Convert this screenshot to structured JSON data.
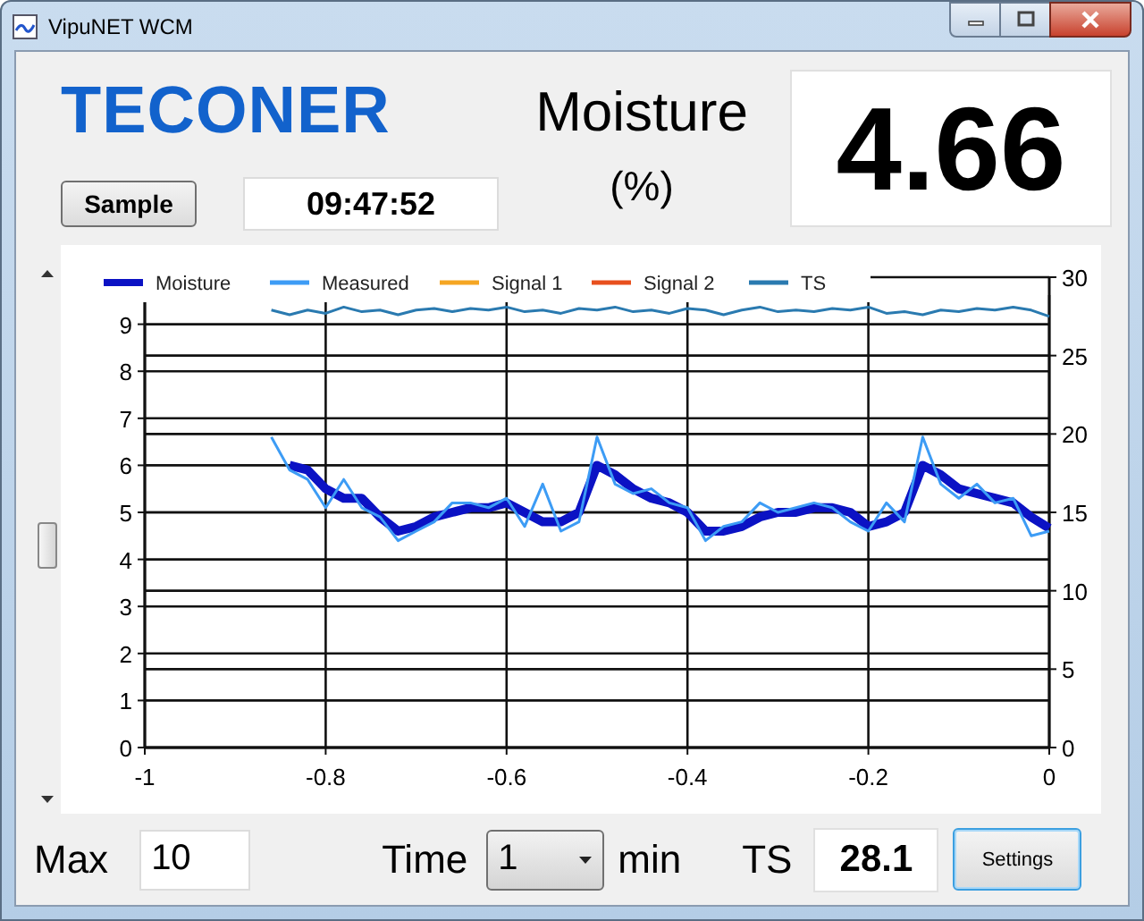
{
  "window": {
    "title": "VipuNET WCM"
  },
  "logo": "TECONER",
  "sample_button": "Sample",
  "time": "09:47:52",
  "measure_label": "Moisture",
  "measure_unit": "(%)",
  "reading": "4.66",
  "chart": {
    "chart_data": {
      "type": "line",
      "x": [
        -0.86,
        -0.84,
        -0.82,
        -0.8,
        -0.78,
        -0.76,
        -0.74,
        -0.72,
        -0.7,
        -0.68,
        -0.66,
        -0.64,
        -0.62,
        -0.6,
        -0.58,
        -0.56,
        -0.54,
        -0.52,
        -0.5,
        -0.48,
        -0.46,
        -0.44,
        -0.42,
        -0.4,
        -0.38,
        -0.36,
        -0.34,
        -0.32,
        -0.3,
        -0.28,
        -0.26,
        -0.24,
        -0.22,
        -0.2,
        -0.18,
        -0.16,
        -0.14,
        -0.12,
        -0.1,
        -0.08,
        -0.06,
        -0.04,
        -0.02,
        0
      ],
      "grid": true,
      "legend": "top",
      "xlim": [
        -1,
        0
      ],
      "ylim": [
        0,
        10
      ],
      "y2lim": [
        0,
        30
      ],
      "xticks": [
        -1,
        -0.8,
        -0.6,
        -0.4,
        -0.2,
        0
      ],
      "yticks": [
        0,
        1,
        2,
        3,
        4,
        5,
        6,
        7,
        8,
        9
      ],
      "y2ticks": [
        0,
        5,
        10,
        15,
        20,
        25,
        30
      ],
      "series": [
        {
          "name": "Moisture",
          "color": "#0b12c4",
          "values": [
            null,
            6.0,
            5.9,
            5.5,
            5.3,
            5.3,
            4.9,
            4.6,
            4.7,
            4.9,
            5.0,
            5.1,
            5.1,
            5.2,
            5.0,
            4.8,
            4.8,
            5.0,
            6.0,
            5.8,
            5.5,
            5.3,
            5.2,
            5.0,
            4.6,
            4.6,
            4.7,
            4.9,
            5.0,
            5.0,
            5.1,
            5.1,
            5.0,
            4.7,
            4.8,
            5.0,
            6.0,
            5.8,
            5.5,
            5.4,
            5.3,
            5.2,
            4.9,
            4.66
          ]
        },
        {
          "name": "Measured",
          "color": "#3d9cf5",
          "values": [
            6.6,
            5.9,
            5.7,
            5.1,
            5.7,
            5.1,
            4.9,
            4.4,
            4.6,
            4.8,
            5.2,
            5.2,
            5.1,
            5.3,
            4.7,
            5.6,
            4.6,
            4.8,
            6.6,
            5.6,
            5.4,
            5.5,
            5.2,
            5.1,
            4.4,
            4.7,
            4.8,
            5.2,
            5.0,
            5.1,
            5.2,
            5.1,
            4.8,
            4.6,
            5.2,
            4.8,
            6.6,
            5.6,
            5.3,
            5.6,
            5.2,
            5.3,
            4.5,
            4.6
          ]
        },
        {
          "name": "Signal 1",
          "color": "#f5a623",
          "values": [
            null,
            null,
            null,
            null,
            null,
            null,
            null,
            null,
            null,
            null,
            null,
            null,
            null,
            null,
            null,
            null,
            null,
            null,
            null,
            null,
            null,
            null,
            null,
            null,
            null,
            null,
            null,
            null,
            null,
            null,
            null,
            null,
            null,
            null,
            null,
            null,
            null,
            null,
            null,
            null,
            null,
            null,
            null,
            null
          ]
        },
        {
          "name": "Signal 2",
          "color": "#e8501e",
          "values": [
            null,
            null,
            null,
            null,
            null,
            null,
            null,
            null,
            null,
            null,
            null,
            null,
            null,
            null,
            null,
            null,
            null,
            null,
            null,
            null,
            null,
            null,
            null,
            null,
            null,
            null,
            null,
            null,
            null,
            null,
            null,
            null,
            null,
            null,
            null,
            null,
            null,
            null,
            null,
            null,
            null,
            null,
            null,
            null
          ]
        },
        {
          "name": "TS",
          "color": "#2a7ab0",
          "axis": "y2",
          "values": [
            27.9,
            27.6,
            27.9,
            27.7,
            28.1,
            27.8,
            27.9,
            27.6,
            27.9,
            28.0,
            27.8,
            28.0,
            27.9,
            28.1,
            27.8,
            27.9,
            27.7,
            28.0,
            27.9,
            28.1,
            27.8,
            27.9,
            27.7,
            28.0,
            27.9,
            27.6,
            27.9,
            28.1,
            27.8,
            27.9,
            27.8,
            28.0,
            27.9,
            28.1,
            27.7,
            27.8,
            27.6,
            27.9,
            27.8,
            28.0,
            27.9,
            28.1,
            27.9,
            27.5
          ]
        }
      ]
    }
  },
  "controls": {
    "max_label": "Max",
    "max_value": "10",
    "time_label": "Time",
    "time_value": "1",
    "time_unit": "min",
    "ts_label": "TS",
    "ts_value": "28.1",
    "settings_button": "Settings"
  }
}
